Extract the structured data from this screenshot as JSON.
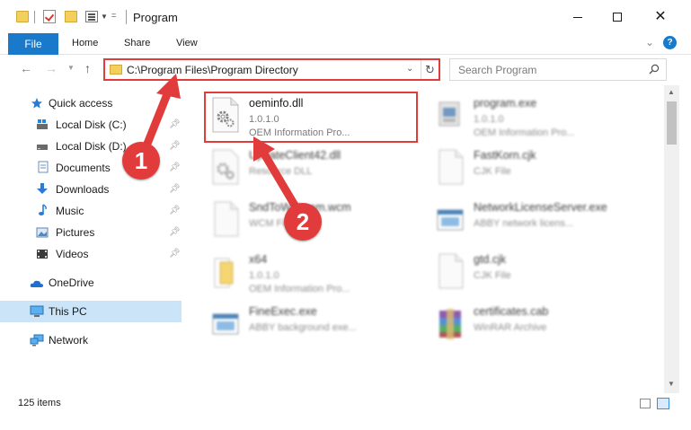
{
  "window": {
    "title": "Program"
  },
  "ribbon": {
    "file": "File",
    "home": "Home",
    "share": "Share",
    "view": "View",
    "help": "?"
  },
  "nav": {
    "address": "C:\\Program Files\\Program Directory",
    "search_placeholder": "Search Program"
  },
  "sidebar": {
    "quick_access": "Quick access",
    "local_c": "Local Disk (C:)",
    "local_d": "Local Disk (D:)",
    "documents": "Documents",
    "downloads": "Downloads",
    "music": "Music",
    "pictures": "Pictures",
    "videos": "Videos",
    "onedrive": "OneDrive",
    "this_pc": "This PC",
    "network": "Network"
  },
  "files": [
    {
      "name": "oeminfo.dll",
      "line2": "1.0.1.0",
      "line3": "OEM Information Pro...",
      "icon": "dll-gear-icon"
    },
    {
      "name": "program.exe",
      "line2": "1.0.1.0",
      "line3": "OEM Information Pro...",
      "icon": "exe-icon"
    },
    {
      "name": "UpdateClient42.dll",
      "line2": "Resource DLL",
      "line3": "",
      "icon": "dll-gear-icon"
    },
    {
      "name": "FastKorn.cjk",
      "line2": "CJK File",
      "line3": "",
      "icon": "blank-file-icon"
    },
    {
      "name": "SndToWebcam.wcm",
      "line2": "WCM File",
      "line3": "",
      "icon": "blank-file-icon"
    },
    {
      "name": "NetworkLicenseServer.exe",
      "line2": "ABBY network licens...",
      "line3": "",
      "icon": "window-exe-icon"
    },
    {
      "name": "x64",
      "line2": "1.0.1.0",
      "line3": "OEM Information Pro...",
      "icon": "folder-icon"
    },
    {
      "name": "gtd.cjk",
      "line2": "CJK File",
      "line3": "",
      "icon": "blank-file-icon"
    },
    {
      "name": "FineExec.exe",
      "line2": "ABBY background exe...",
      "line3": "",
      "icon": "window-exe-icon"
    },
    {
      "name": "certificates.cab",
      "line2": "WinRAR Archive",
      "line3": "",
      "icon": "winrar-icon"
    }
  ],
  "status": {
    "items": "125 items"
  },
  "annotations": {
    "step1": "1",
    "step2": "2"
  },
  "colors": {
    "accent": "#1979ca",
    "highlight_red": "#e23b3b",
    "selection": "#cce4f7"
  }
}
